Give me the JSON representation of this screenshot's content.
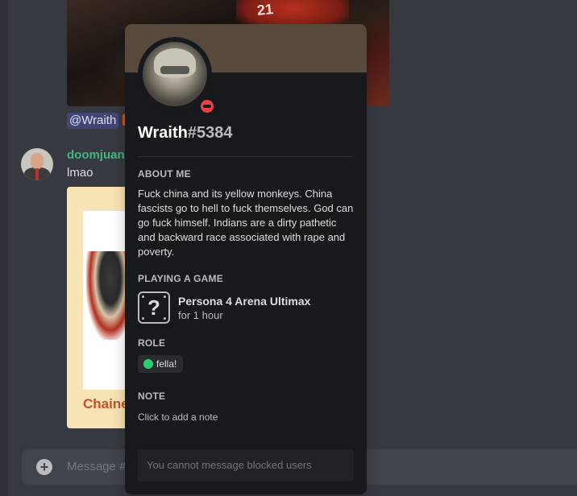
{
  "chat": {
    "top_image": {
      "number_tag": "21"
    },
    "mention": "@Wraith",
    "message2": {
      "username": "doomjuan",
      "username_color": "#43b581",
      "text": "lmao",
      "image_caption": "Chaine"
    },
    "message_bar": {
      "placeholder": "Message #"
    }
  },
  "profile": {
    "banner_color": "#574a3d",
    "status": "do-not-disturb",
    "status_color": "#ed4245",
    "username": "Wraith",
    "discriminator": "#5384",
    "about_me": {
      "title": "ABOUT ME",
      "text": "Fuck china and its yellow monkeys. China fascists go to hell to fuck themselves. God can go fuck himself. Indians are a dirty pathetic and backward race associated with rape and poverty."
    },
    "activity": {
      "title": "PLAYING A GAME",
      "game_name": "Persona 4 Arena Ultimax",
      "duration": "for 1 hour",
      "icon": "unknown-game-icon"
    },
    "roles": {
      "title": "ROLE",
      "items": [
        {
          "name": "fella!",
          "color": "#2ecc71"
        }
      ]
    },
    "note": {
      "title": "NOTE",
      "placeholder": "Click to add a note"
    },
    "message_input_placeholder": "You cannot message blocked users"
  }
}
